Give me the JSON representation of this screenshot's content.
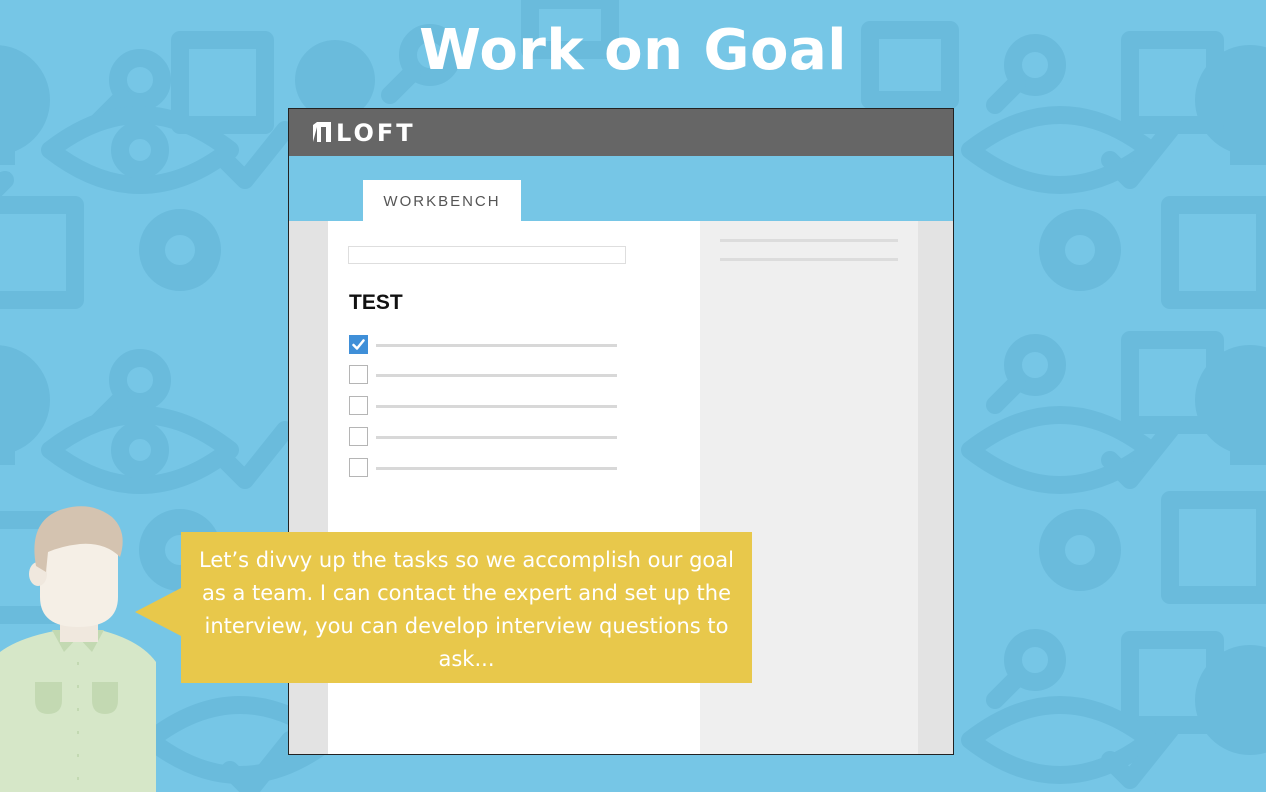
{
  "page": {
    "title": "Work on Goal"
  },
  "app": {
    "logo_text": "LOFT",
    "tab_label": "WORKBENCH",
    "list_title": "TEST",
    "tasks": [
      {
        "checked": true
      },
      {
        "checked": false
      },
      {
        "checked": false
      },
      {
        "checked": false
      },
      {
        "checked": false
      }
    ]
  },
  "speech": {
    "text": "Let’s divvy up the tasks so we accomplish our goal as a team. I can contact the expert and set up the interview, you can develop interview questions to ask..."
  },
  "colors": {
    "background": "#76c6e6",
    "header": "#666666",
    "checkbox_checked": "#3f8fd8",
    "speech_bubble": "#e8c84b"
  },
  "icons": [
    "lightbulb-icon",
    "magnifier-icon",
    "cube-icon",
    "eye-icon",
    "checkmark-icon",
    "gear-icon",
    "loft-logo-icon",
    "check-icon"
  ]
}
